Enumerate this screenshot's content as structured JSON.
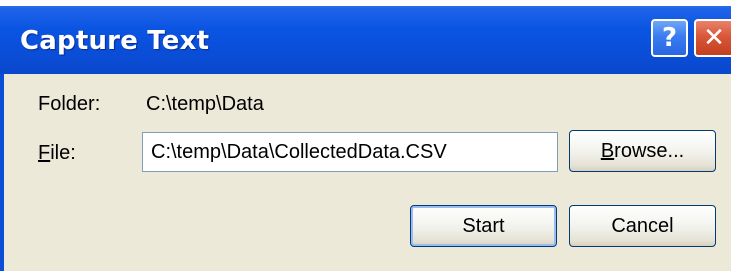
{
  "window": {
    "title": "Capture Text",
    "help_label": "?",
    "close_label": "✕"
  },
  "form": {
    "folder_label": "Folder:",
    "folder_value": "C:\\temp\\Data",
    "file_label_first": "F",
    "file_label_rest": "ile:",
    "file_value": "C:\\temp\\Data\\CollectedData.CSV"
  },
  "buttons": {
    "browse_first": "B",
    "browse_rest": "rowse...",
    "start_label": "Start",
    "cancel_label": "Cancel"
  },
  "icons": {
    "help": "help-icon",
    "close": "close-icon"
  }
}
